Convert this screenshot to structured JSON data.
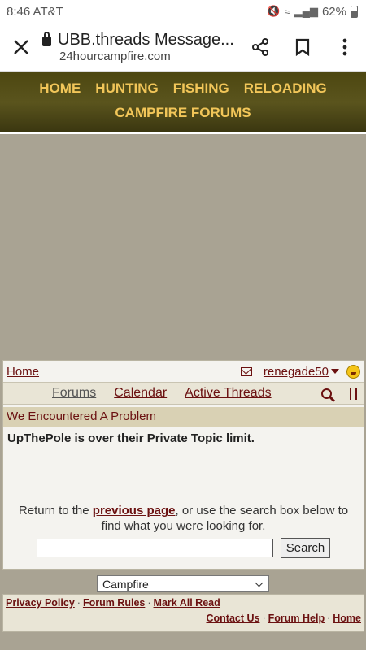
{
  "status": {
    "time": "8:46",
    "carrier": "AT&T",
    "battery": "62%",
    "icons": [
      "mute-icon",
      "wifi-icon",
      "signal-icon"
    ]
  },
  "browser": {
    "title": "UBB.threads Message...",
    "url": "24hourcampfire.com"
  },
  "site_nav": {
    "items": [
      "HOME",
      "HUNTING",
      "FISHING",
      "RELOADING"
    ],
    "second_row": "CAMPFIRE FORUMS"
  },
  "forum_bar": {
    "home": "Home",
    "username": "renegade50",
    "tabs": [
      "Forums",
      "Calendar",
      "Active Threads"
    ]
  },
  "problem": {
    "header": "We Encountered A Problem",
    "message": "UpThePole is over their Private Topic limit.",
    "return_prefix": "Return to the ",
    "return_link": "previous page",
    "return_suffix": ", or use the search box below to find what you were looking for.",
    "search_value": "",
    "search_button": "Search"
  },
  "jump": {
    "selected": "Campfire"
  },
  "footer": {
    "row1": [
      "Privacy Policy",
      "Forum Rules",
      "Mark All Read"
    ],
    "row2": [
      "Contact Us",
      "Forum Help",
      "Home"
    ]
  }
}
